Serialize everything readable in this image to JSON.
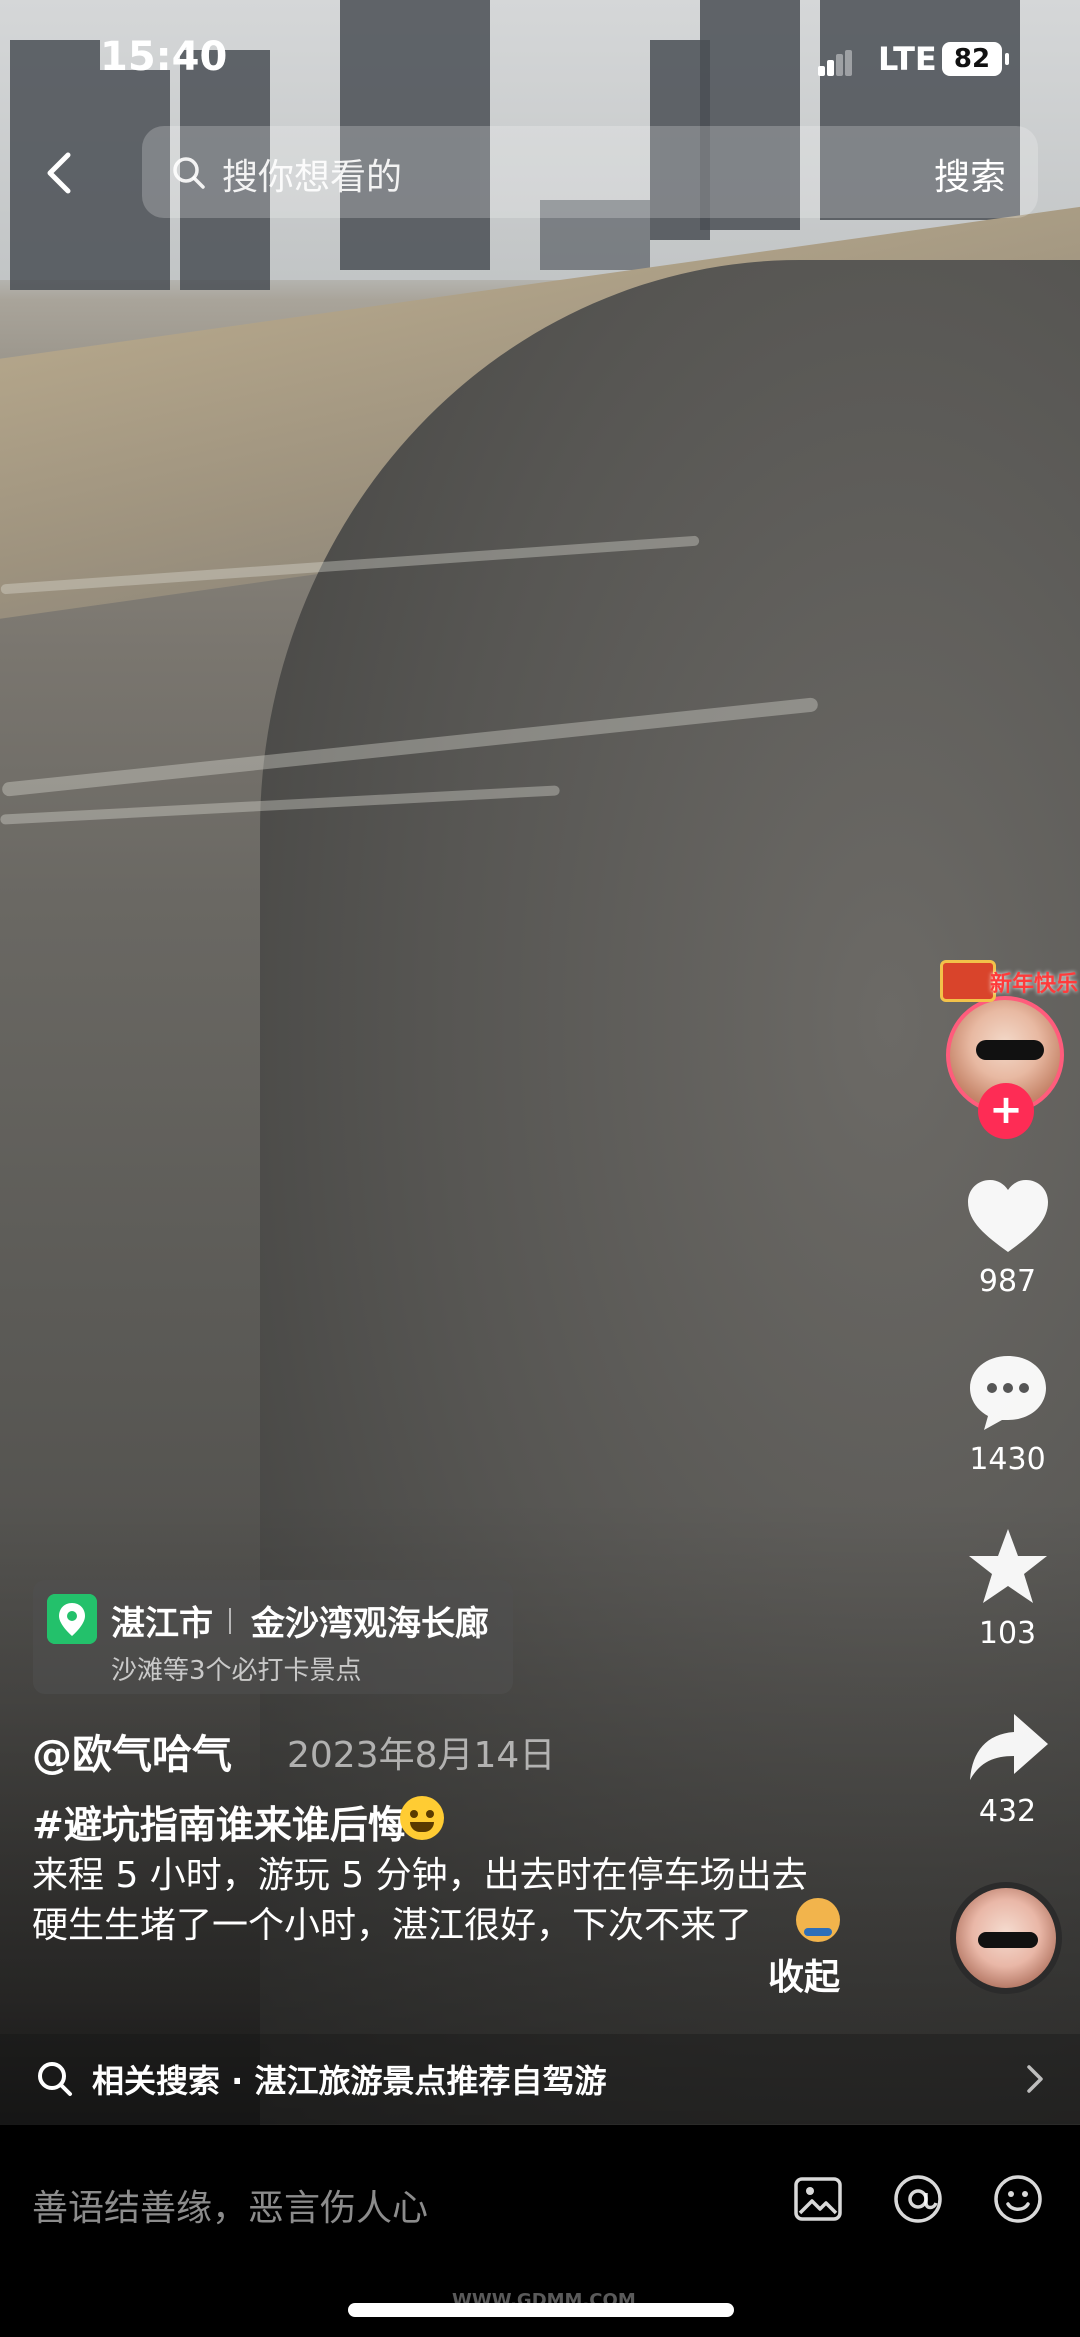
{
  "status_bar": {
    "time": "15:40",
    "network": "LTE",
    "battery": "82"
  },
  "search": {
    "placeholder": "搜你想看的",
    "button_label": "搜索"
  },
  "author_avatar": {
    "badge_text": "新年快乐"
  },
  "actions": {
    "like_count": "987",
    "comment_count": "1430",
    "favorite_count": "103",
    "share_count": "432"
  },
  "location": {
    "city": "湛江市",
    "place": "金沙湾观海长廊",
    "subtitle": "沙滩等3个必打卡景点"
  },
  "post": {
    "author": "@欧气哈气",
    "date": "2023年8月14日",
    "hashtag": "#避坑指南谁来谁后悔",
    "line1": "来程 5 小时，游玩 5 分钟，出去时在停车场出去",
    "line2": "硬生生堵了一个小时，湛江很好，下次不来了",
    "collapse_label": "收起"
  },
  "related_search": {
    "label": "相关搜索 · 湛江旅游景点推荐自驾游"
  },
  "comment_bar": {
    "placeholder": "善语结善缘，恶言伤人心"
  },
  "watermark": "WWW.GDMM.COM",
  "colors": {
    "accent": "#fe2c55",
    "location_pin": "#23c16b"
  }
}
